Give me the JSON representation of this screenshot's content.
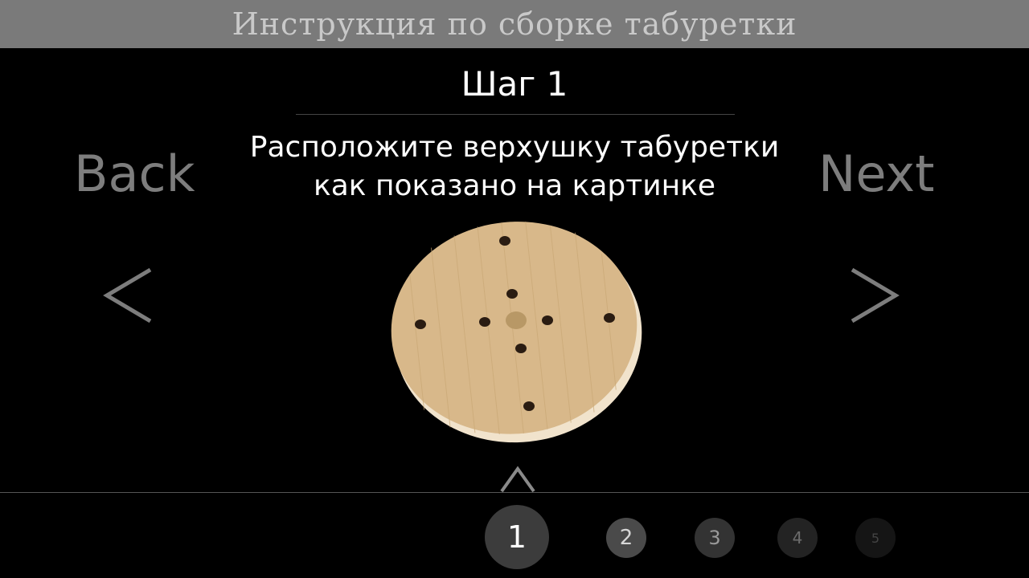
{
  "header": {
    "title": "Инструкция по сборке табуретки"
  },
  "step": {
    "title": "Шаг 1",
    "instruction_line1": "Расположите верхушку табуретки",
    "instruction_line2": "как показано на картинке"
  },
  "nav": {
    "back_label": "Back",
    "next_label": "Next",
    "prev_icon": "chevron-left-icon",
    "next_icon": "chevron-right-icon",
    "expand_icon": "chevron-up-icon"
  },
  "image": {
    "subject": "stool-top-disc",
    "color": "#d8b88a"
  },
  "pagination": {
    "pages": [
      "1",
      "2",
      "3",
      "4",
      "5"
    ],
    "current": "1"
  },
  "colors": {
    "header_bg": "#7a7a7a",
    "background": "#000000",
    "nav_text": "#7d7d7d"
  }
}
